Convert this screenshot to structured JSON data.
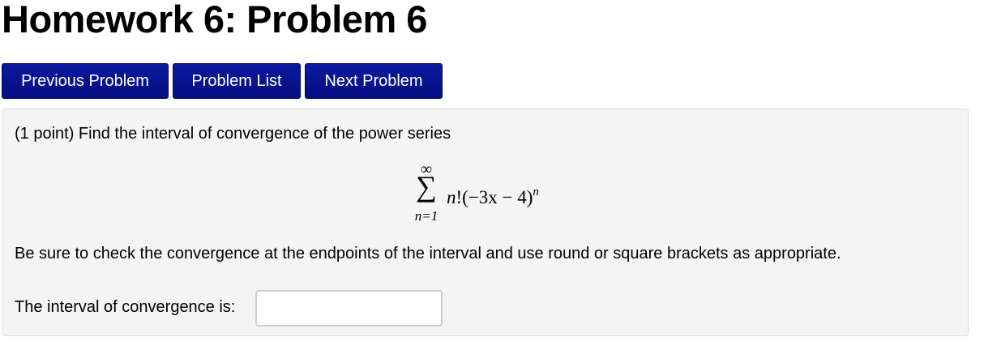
{
  "page": {
    "title": "Homework 6: Problem 6"
  },
  "nav": {
    "previous_label": "Previous Problem",
    "list_label": "Problem List",
    "next_label": "Next Problem"
  },
  "problem": {
    "intro": "(1 point) Find the interval of convergence of the power series",
    "series": {
      "upper_limit": "∞",
      "symbol": "∑",
      "lower_limit": "n=1",
      "term_var": "n",
      "term_rest": "!(−3x − 4)",
      "exponent": "n"
    },
    "instructions": "Be sure to check the convergence at the endpoints of the interval and use round or square brackets as appropriate.",
    "answer_label": "The interval of convergence is:",
    "answer_value": "",
    "answer_placeholder": ""
  },
  "colors": {
    "button_bg": "#0b1aa0",
    "button_text": "#ffffff",
    "panel_bg": "#f4f4f4"
  }
}
